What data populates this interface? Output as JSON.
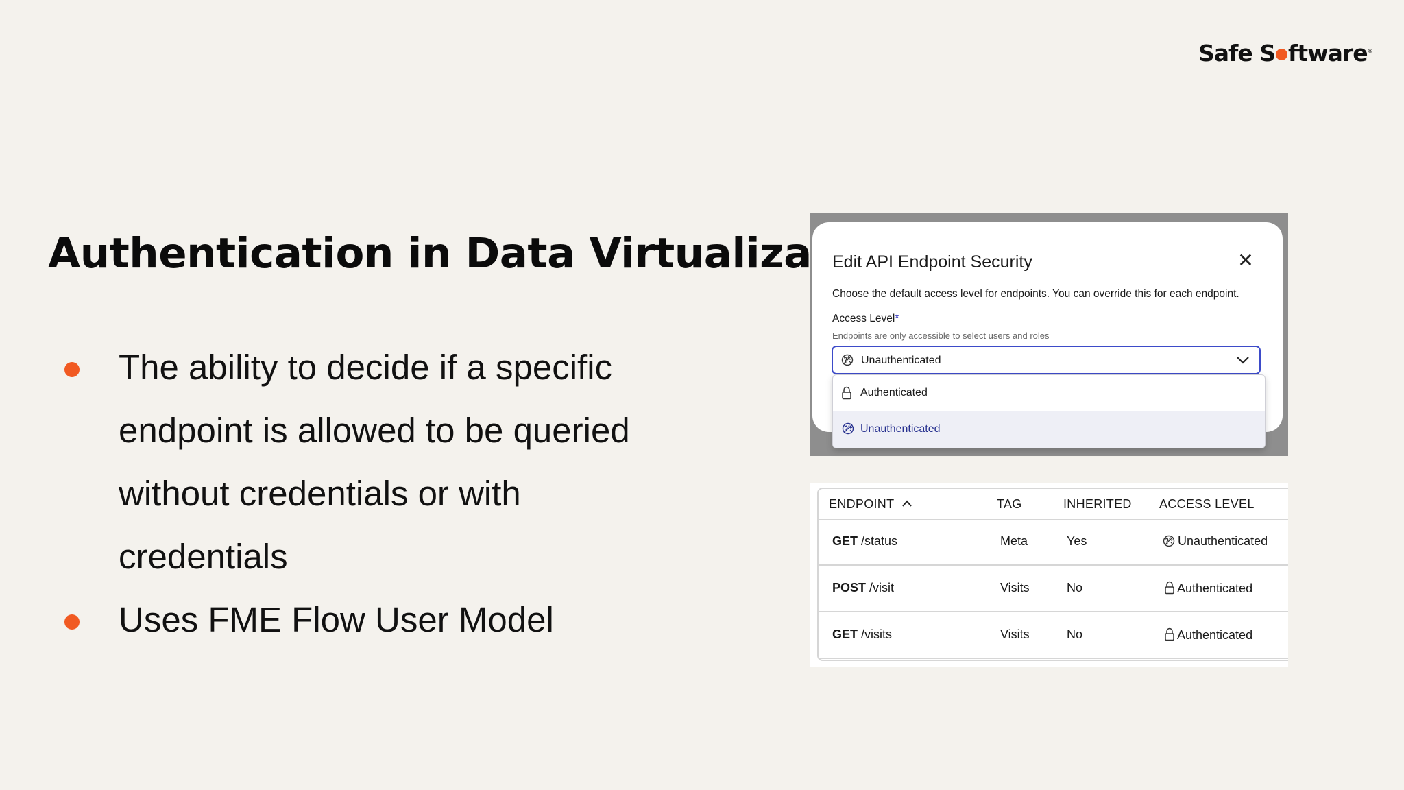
{
  "brand": {
    "logo_before": "Safe S",
    "logo_after": "ftware",
    "logo_mark": "®"
  },
  "slide": {
    "title": "Authentication in Data Virtualization",
    "bullets": [
      "The ability to decide if a specific endpoint is allowed to be queried without credentials or with credentials",
      "Uses FME Flow User Model"
    ]
  },
  "dialog": {
    "title": "Edit API Endpoint Security",
    "close_glyph": "✕",
    "description": "Choose the default access level for endpoints. You can override this for each endpoint.",
    "access_label": "Access Level",
    "required_mark": "*",
    "help_text": "Endpoints are only accessible to select users and roles",
    "selected_value": "Unauthenticated",
    "options": [
      {
        "label": "Authenticated",
        "icon": "lock-icon"
      },
      {
        "label": "Unauthenticated",
        "icon": "globe-icon"
      }
    ]
  },
  "table": {
    "columns": [
      "ENDPOINT",
      "TAG",
      "INHERITED",
      "ACCESS LEVEL"
    ],
    "rows": [
      {
        "method": "GET",
        "path": "/status",
        "tag": "Meta",
        "inherited": "Yes",
        "access": "Unauthenticated",
        "icon": "globe-icon"
      },
      {
        "method": "POST",
        "path": "/visit",
        "tag": "Visits",
        "inherited": "No",
        "access": "Authenticated",
        "icon": "lock-icon"
      },
      {
        "method": "GET",
        "path": "/visits",
        "tag": "Visits",
        "inherited": "No",
        "access": "Authenticated",
        "icon": "lock-icon"
      }
    ]
  },
  "colors": {
    "accent": "#f15a22",
    "focus": "#3d4bc9",
    "background": "#f4f2ed"
  }
}
